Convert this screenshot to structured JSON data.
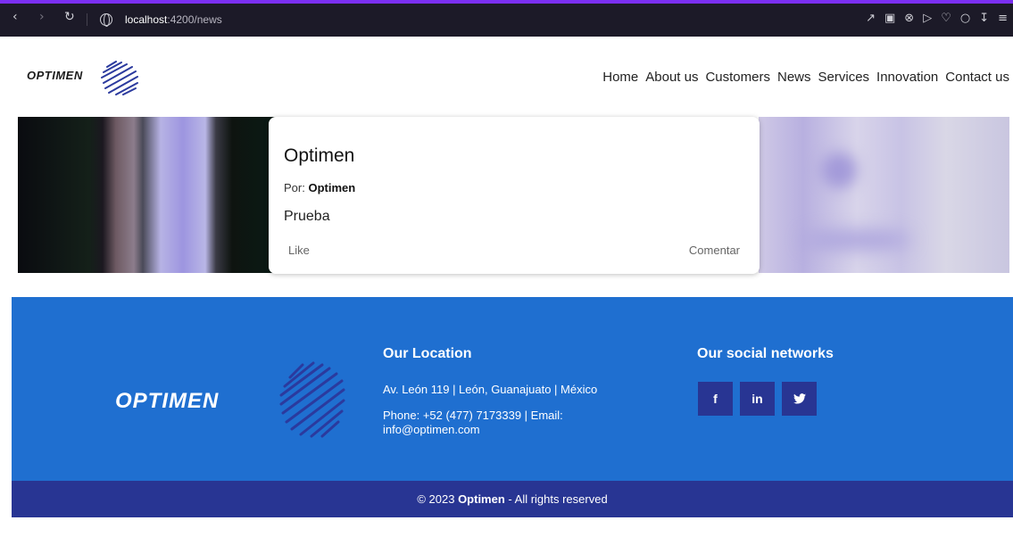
{
  "browser": {
    "url_host": "localhost",
    "url_path": ":4200/news",
    "icons": [
      "back-icon",
      "forward-icon",
      "reload-icon",
      "site-info-icon",
      "share-icon",
      "screenshot-icon",
      "close-circle-icon",
      "send-icon",
      "heart-icon",
      "profile-icon",
      "download-icon",
      "menu-icon"
    ]
  },
  "header": {
    "logo_text": "OPTIMEN",
    "menu": [
      "Home",
      "About us",
      "Customers",
      "News",
      "Services",
      "Innovation",
      "Contact us"
    ]
  },
  "post": {
    "title": "Optimen",
    "author_label": "Por:",
    "author": "Optimen",
    "body": "Prueba",
    "like_label": "Like",
    "comment_label": "Comentar"
  },
  "footer": {
    "logo_text": "OPTIMEN",
    "location_title": "Our Location",
    "address": "Av. León 119 | León, Guanajuato | México",
    "contact": "Phone: +52 (477) 7173339 | Email: info@optimen.com",
    "social_title": "Our social networks",
    "social": [
      {
        "name": "facebook",
        "label": "f"
      },
      {
        "name": "linkedin",
        "label": "in"
      },
      {
        "name": "twitter",
        "label": "🐦"
      }
    ],
    "copyright_prefix": "© 2023",
    "copyright_brand": "Optimen",
    "copyright_suffix": "- All rights reserved"
  },
  "colors": {
    "footer_bg": "#1f6fd0",
    "copyright_bg": "#283593",
    "social_bg": "#283593",
    "logo_lines": "#2b3a9e"
  }
}
